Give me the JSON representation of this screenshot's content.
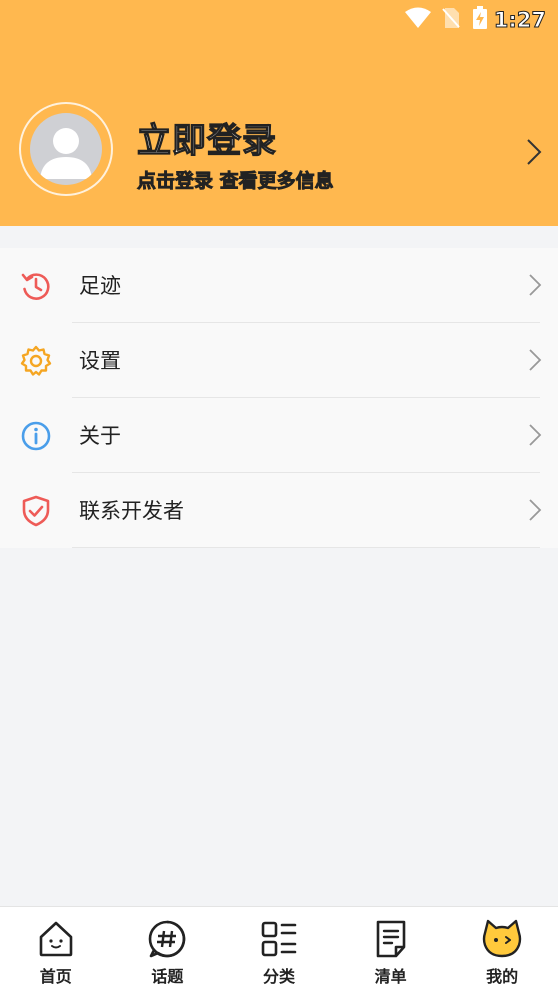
{
  "status_bar": {
    "time": "1:27",
    "icons": [
      "wifi-icon",
      "no-sim-icon",
      "battery-charging-icon"
    ]
  },
  "profile": {
    "title": "立即登录",
    "subtitle": "点击登录 查看更多信息",
    "avatar_icon": "default-avatar-icon",
    "chevron_icon": "chevron-right-icon"
  },
  "menu": {
    "items": [
      {
        "label": "足迹",
        "icon": "history-icon",
        "color": "#EE5B57"
      },
      {
        "label": "设置",
        "icon": "gear-icon",
        "color": "#F5A623"
      },
      {
        "label": "关于",
        "icon": "info-icon",
        "color": "#4A9EEA"
      },
      {
        "label": "联系开发者",
        "icon": "shield-icon",
        "color": "#EE5B57"
      }
    ]
  },
  "tabbar": {
    "tabs": [
      {
        "label": "首页",
        "icon": "home-icon"
      },
      {
        "label": "话题",
        "icon": "hashtag-icon"
      },
      {
        "label": "分类",
        "icon": "category-icon"
      },
      {
        "label": "清单",
        "icon": "list-icon"
      },
      {
        "label": "我的",
        "icon": "cat-face-icon",
        "active": true
      }
    ]
  },
  "colors": {
    "header": "#FFB84F",
    "background": "#f3f4f6",
    "menu_bg": "#f9f9f9"
  }
}
